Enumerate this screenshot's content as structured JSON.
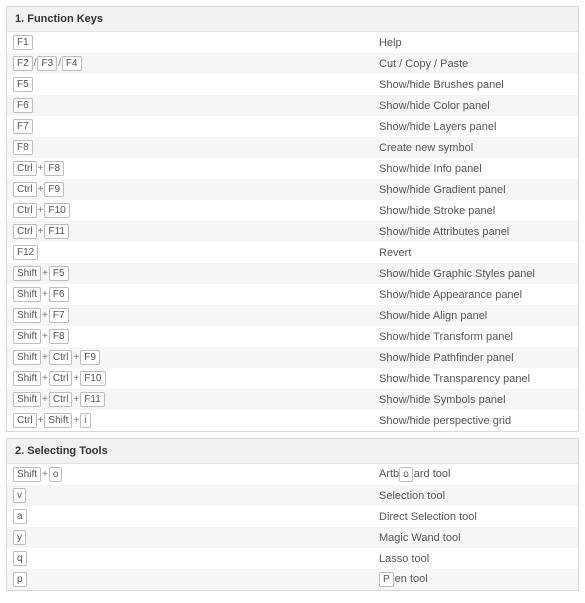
{
  "sections": [
    {
      "title": "1. Function Keys",
      "rows": [
        {
          "keys": [
            [
              "F1"
            ]
          ],
          "desc": "Help"
        },
        {
          "keys": [
            [
              "F2"
            ],
            [
              "F3"
            ],
            [
              "F4"
            ]
          ],
          "join": "/",
          "desc": "Cut / Copy / Paste"
        },
        {
          "keys": [
            [
              "F5"
            ]
          ],
          "desc": "Show/hide Brushes panel"
        },
        {
          "keys": [
            [
              "F6"
            ]
          ],
          "desc": "Show/hide Color panel"
        },
        {
          "keys": [
            [
              "F7"
            ]
          ],
          "desc": "Show/hide Layers panel"
        },
        {
          "keys": [
            [
              "F8"
            ]
          ],
          "desc": "Create new symbol"
        },
        {
          "keys": [
            [
              "Ctrl",
              "F8"
            ]
          ],
          "desc": "Show/hide Info panel"
        },
        {
          "keys": [
            [
              "Ctrl",
              "F9"
            ]
          ],
          "desc": "Show/hide Gradient panel"
        },
        {
          "keys": [
            [
              "Ctrl",
              "F10"
            ]
          ],
          "desc": "Show/hide Stroke panel"
        },
        {
          "keys": [
            [
              "Ctrl",
              "F11"
            ]
          ],
          "desc": "Show/hide Attributes panel"
        },
        {
          "keys": [
            [
              "F12"
            ]
          ],
          "desc": "Revert"
        },
        {
          "keys": [
            [
              "Shift",
              "F5"
            ]
          ],
          "desc": "Show/hide Graphic Styles panel"
        },
        {
          "keys": [
            [
              "Shift",
              "F6"
            ]
          ],
          "desc": "Show/hide Appearance panel"
        },
        {
          "keys": [
            [
              "Shift",
              "F7"
            ]
          ],
          "desc": "Show/hide Align panel"
        },
        {
          "keys": [
            [
              "Shift",
              "F8"
            ]
          ],
          "desc": "Show/hide Transform panel"
        },
        {
          "keys": [
            [
              "Shift",
              "Ctrl",
              "F9"
            ]
          ],
          "desc": "Show/hide Pathfinder panel"
        },
        {
          "keys": [
            [
              "Shift",
              "Ctrl",
              "F10"
            ]
          ],
          "desc": "Show/hide Transparency panel"
        },
        {
          "keys": [
            [
              "Shift",
              "Ctrl",
              "F11"
            ]
          ],
          "desc": "Show/hide Symbols panel"
        },
        {
          "keys": [
            [
              "Ctrl",
              "Shift",
              "i"
            ]
          ],
          "desc": "Show/hide perspective grid"
        }
      ]
    },
    {
      "title": "2. Selecting Tools",
      "rows": [
        {
          "keys": [
            [
              "Shift",
              "o"
            ]
          ],
          "desc_html": "Artb<span class=\"key\" data-name=\"inline-key\" data-interactable=\"false\">o</span>ard tool"
        },
        {
          "keys": [
            [
              "v"
            ]
          ],
          "desc": "Selection tool"
        },
        {
          "keys": [
            [
              "a"
            ]
          ],
          "desc": "Direct Selection tool"
        },
        {
          "keys": [
            [
              "y"
            ]
          ],
          "desc": "Magic Wand tool"
        },
        {
          "keys": [
            [
              "q"
            ]
          ],
          "desc": "Lasso tool"
        },
        {
          "keys": [
            [
              "p"
            ]
          ],
          "desc_html": "<span class=\"key\" data-name=\"inline-key\" data-interactable=\"false\">P</span>en tool"
        }
      ]
    }
  ]
}
